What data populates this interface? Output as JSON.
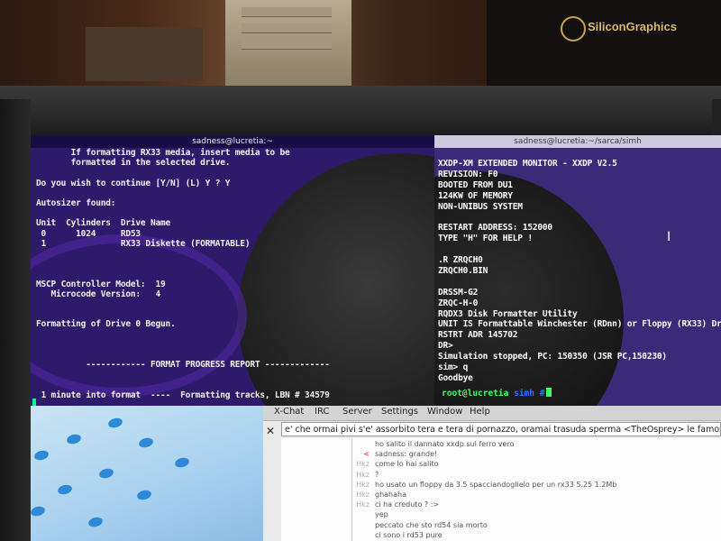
{
  "left_terminal": {
    "title": "sadness@lucretia:~",
    "lines": [
      "       If formatting RX33 media, insert media to be",
      "       formatted in the selected drive.",
      "",
      "Do you wish to continue [Y/N] (L) Y ? Y",
      "",
      "Autosizer found:",
      "",
      "Unit  Cylinders  Drive Name",
      " 0      1024     RD53",
      " 1               RX33 Diskette (FORMATABLE)",
      "",
      "",
      "",
      "MSCP Controller Model:  19",
      "   Microcode Version:   4",
      "",
      "",
      "Formatting of Drive 0 Begun.",
      "",
      "",
      "",
      "          ------------ FORMAT PROGRESS REPORT -------------",
      "",
      "",
      " 1 minute into format  ----  Formatting tracks, LBN # 34579"
    ]
  },
  "right_terminal": {
    "title": "sadness@lucretia:~/sarca/simh",
    "lines": [
      "",
      "XXDP-XM EXTENDED MONITOR - XXDP V2.5",
      "REVISION: F0",
      "BOOTED FROM DU1",
      "124KW OF MEMORY",
      "NON-UNIBUS SYSTEM",
      "",
      "RESTART ADDRESS: 152000",
      "TYPE \"H\" FOR HELP !",
      "",
      ".R ZRQCH0",
      "ZRQCH0.BIN",
      "",
      "DRSSM-G2",
      "ZRQC-H-0",
      "RQDX3 Disk Formatter Utility",
      "UNIT IS Formattable Winchester (RDnn) or Floppy (RX33) Drive",
      "RSTRT ADR 145702",
      "DR>",
      "Simulation stopped, PC: 150350 (JSR PC,150230)",
      "sim> q",
      "Goodbye"
    ],
    "prompt_user": "root@lucretia",
    "prompt_path": "simh #"
  },
  "xchat": {
    "menu": [
      "X-Chat",
      "IRC",
      "Server",
      "Settings",
      "Window",
      "Help"
    ],
    "topic": "e' che ormai pivi s'e' assorbito tera e tera di pornazzo, oramai trasuda sperma <TheOsprey> le famose nerche",
    "messages": [
      {
        "nick": "",
        "text": "ho salito il dannato xxdp sul ferro vero",
        "red": false
      },
      {
        "nick": "<",
        "text": "sadness: grande!",
        "red": true
      },
      {
        "nick": "Hkz",
        "text": "come lo hai salito",
        "red": false
      },
      {
        "nick": "Hkz",
        "text": "?",
        "red": false
      },
      {
        "nick": "Hkz",
        "text": "ho usato un floppy da 3.5 spacciandoglielo per un rx33 5.25 1.2Mb",
        "red": false
      },
      {
        "nick": "Hkz",
        "text": "ghahaha",
        "red": false
      },
      {
        "nick": "Hkz",
        "text": "ci ha creduto ? :>",
        "red": false
      },
      {
        "nick": "",
        "text": "yep",
        "red": false
      },
      {
        "nick": "",
        "text": "peccato che sto rd54 sia morto",
        "red": false
      },
      {
        "nick": "",
        "text": "ci sono i rd53 pure",
        "red": false
      }
    ]
  },
  "background": {
    "logo_text": "SiliconGraphics"
  }
}
